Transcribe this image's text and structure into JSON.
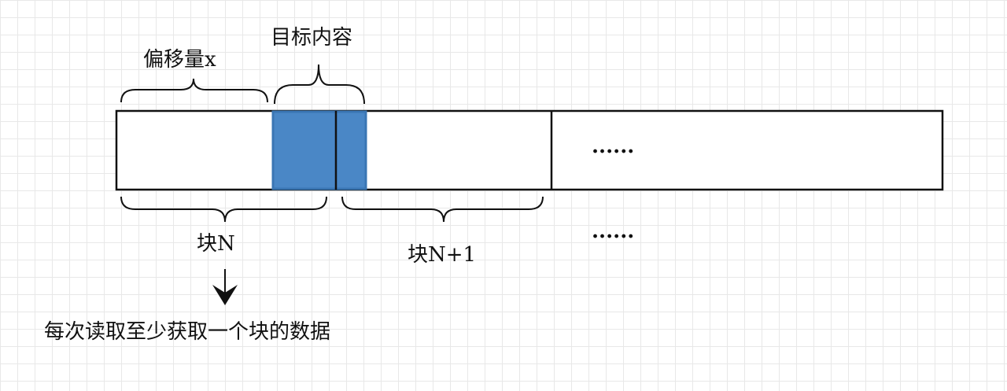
{
  "labels": {
    "offset": "偏移量x",
    "target": "目标内容",
    "block_n": "块N",
    "block_n1": "块N+1",
    "ellipsis_top": "......",
    "ellipsis_bottom": "......",
    "note": "每次读取至少获取一个块的数据"
  },
  "colors": {
    "highlight": "#4a87c6",
    "highlight_border": "#3a76b4",
    "stroke": "#111111"
  }
}
